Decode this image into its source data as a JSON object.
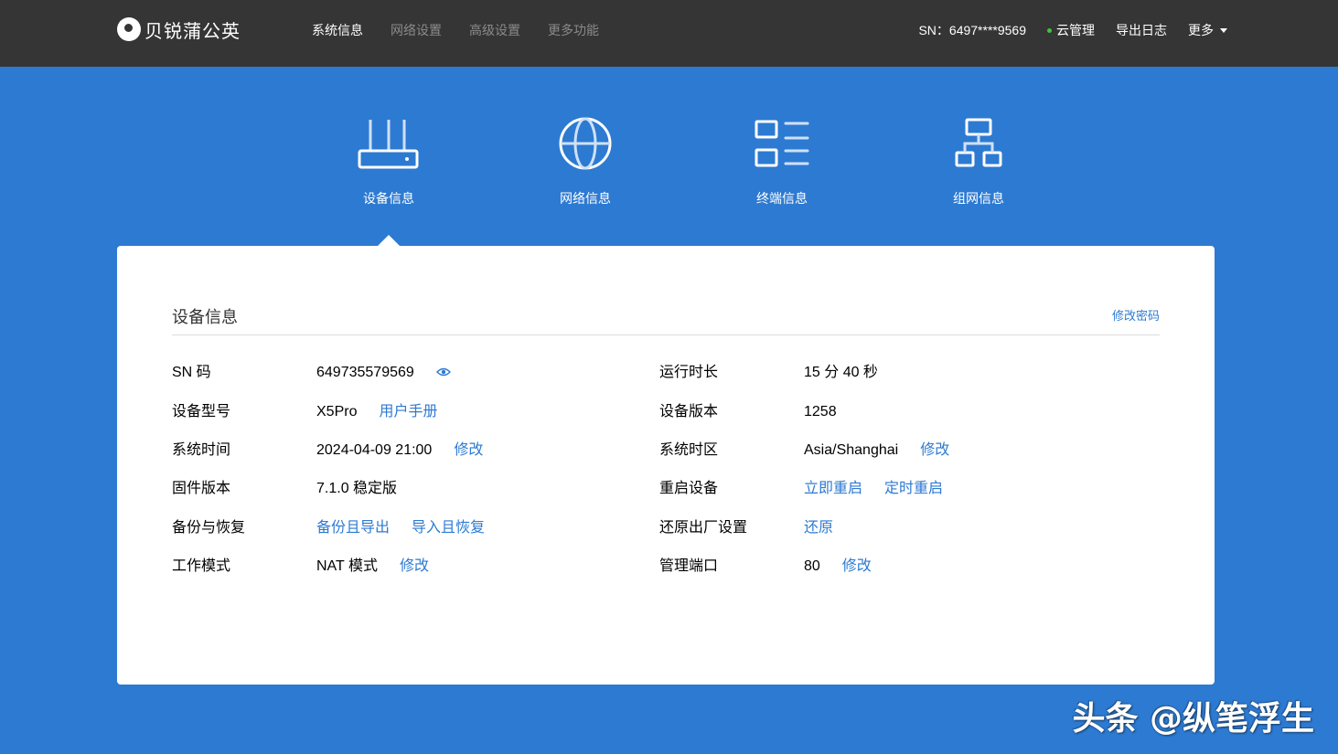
{
  "brand": {
    "name": "贝锐蒲公英"
  },
  "nav": {
    "items": [
      {
        "label": "系统信息",
        "active": true
      },
      {
        "label": "网络设置",
        "active": false
      },
      {
        "label": "高级设置",
        "active": false
      },
      {
        "label": "更多功能",
        "active": false
      }
    ]
  },
  "topright": {
    "sn": "SN：6497****9569",
    "cloud": "云管理",
    "cloud_status_color": "#3ec43e",
    "export_log": "导出日志",
    "more": "更多"
  },
  "tabs": [
    {
      "label": "设备信息",
      "icon": "router-icon",
      "active": true
    },
    {
      "label": "网络信息",
      "icon": "globe-icon",
      "active": false
    },
    {
      "label": "终端信息",
      "icon": "grid-list-icon",
      "active": false
    },
    {
      "label": "组网信息",
      "icon": "network-topology-icon",
      "active": false
    }
  ],
  "panel": {
    "title": "设备信息",
    "change_password": "修改密码",
    "left": [
      {
        "label": "SN 码",
        "value": "649735579569",
        "icon": "eye-icon"
      },
      {
        "label": "设备型号",
        "value": "X5Pro",
        "link": "用户手册"
      },
      {
        "label": "系统时间",
        "value": "2024-04-09 21:00",
        "link": "修改"
      },
      {
        "label": "固件版本",
        "value": "7.1.0 稳定版"
      },
      {
        "label": "备份与恢复",
        "link": "备份且导出",
        "link2": "导入且恢复"
      },
      {
        "label": "工作模式",
        "value": "NAT 模式",
        "link": "修改"
      }
    ],
    "right": [
      {
        "label": "运行时长",
        "value": "15 分 40 秒"
      },
      {
        "label": "设备版本",
        "value": "1258"
      },
      {
        "label": "系统时区",
        "value": "Asia/Shanghai",
        "link": "修改"
      },
      {
        "label": "重启设备",
        "link": "立即重启",
        "link2": "定时重启"
      },
      {
        "label": "还原出厂设置",
        "link": "还原"
      },
      {
        "label": "管理端口",
        "value": "80",
        "link": "修改"
      }
    ]
  },
  "watermark": "头条 @纵笔浮生",
  "colors": {
    "topbar": "#353535",
    "background": "#2d7ad2",
    "link": "#2d7ad2"
  }
}
